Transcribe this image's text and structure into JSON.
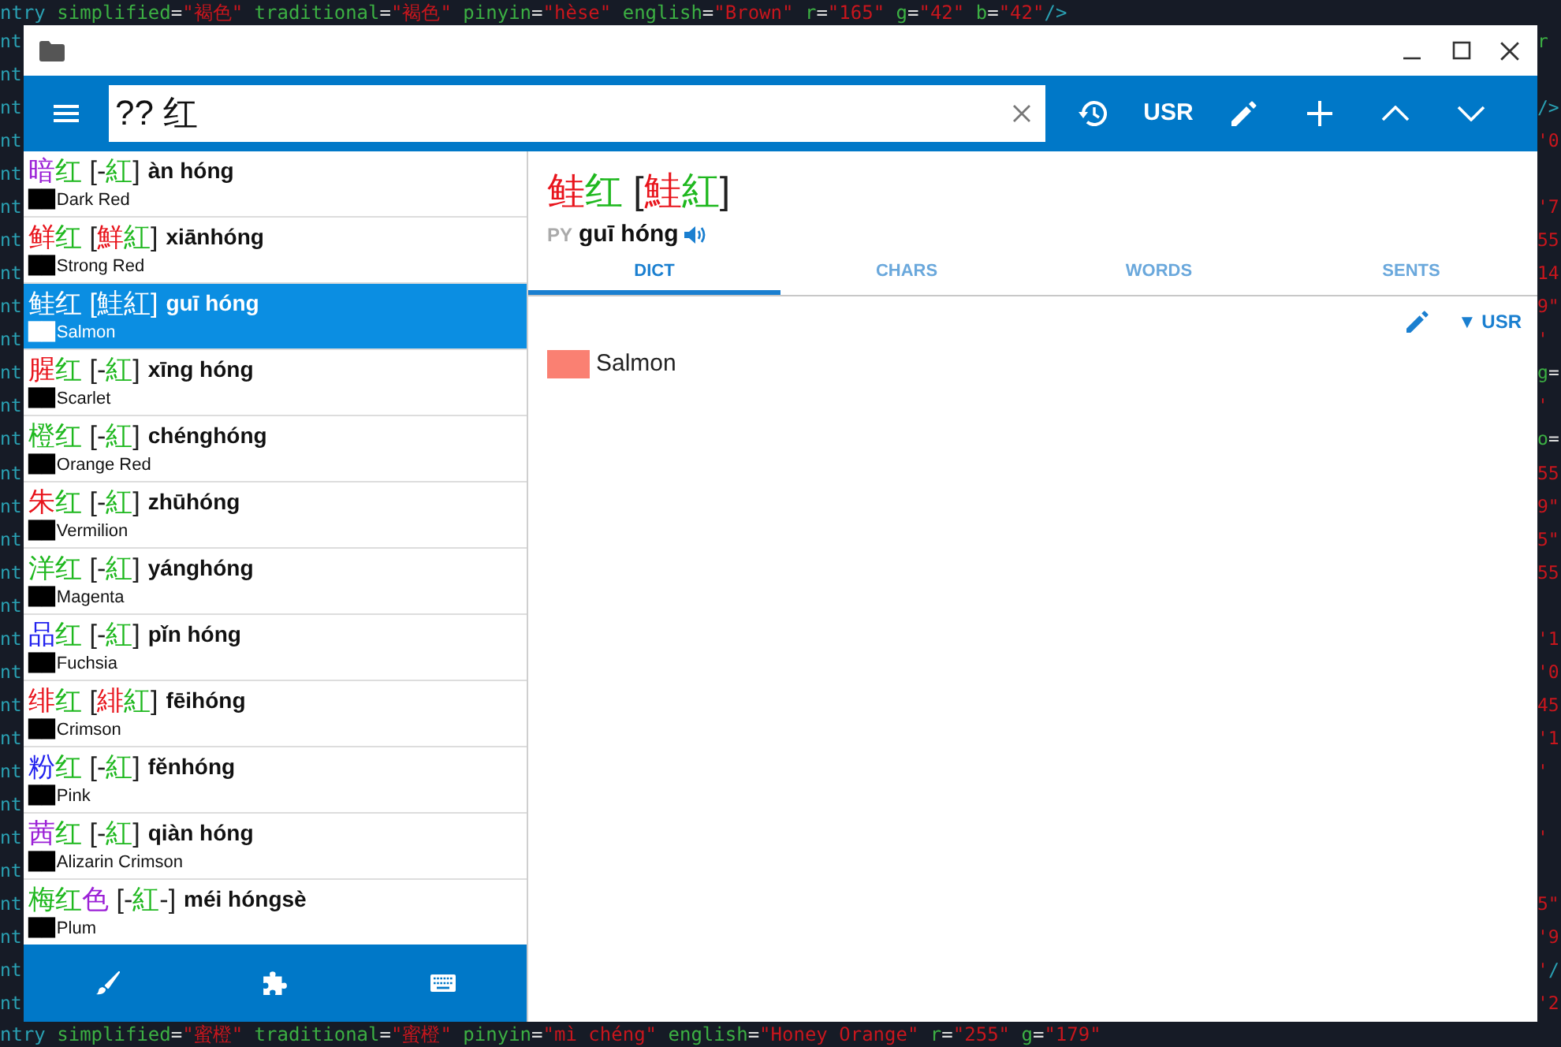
{
  "editor": {
    "top_line": [
      {
        "kind": "tag",
        "text": "ntry "
      },
      {
        "kind": "attr",
        "text": "simplified"
      },
      {
        "kind": "punct",
        "text": "="
      },
      {
        "kind": "string",
        "text": "\"褐色\""
      },
      {
        "kind": "attr",
        "text": " traditional"
      },
      {
        "kind": "punct",
        "text": "="
      },
      {
        "kind": "string",
        "text": "\"褐色\""
      },
      {
        "kind": "attr",
        "text": " pinyin"
      },
      {
        "kind": "punct",
        "text": "="
      },
      {
        "kind": "string",
        "text": "\"hèse\""
      },
      {
        "kind": "attr",
        "text": " english"
      },
      {
        "kind": "punct",
        "text": "="
      },
      {
        "kind": "string",
        "text": "\"Brown\""
      },
      {
        "kind": "attr",
        "text": " r"
      },
      {
        "kind": "punct",
        "text": "="
      },
      {
        "kind": "string",
        "text": "\"165\""
      },
      {
        "kind": "attr",
        "text": " g"
      },
      {
        "kind": "punct",
        "text": "="
      },
      {
        "kind": "string",
        "text": "\"42\""
      },
      {
        "kind": "attr",
        "text": " b"
      },
      {
        "kind": "punct",
        "text": "="
      },
      {
        "kind": "string",
        "text": "\"42\""
      },
      {
        "kind": "tag",
        "text": "/>"
      }
    ],
    "lines": [
      {
        "left": "nt",
        "right": [
          {
            "kind": "attr",
            "text": "r"
          }
        ]
      },
      {
        "left": "nt"
      },
      {
        "left": "nt",
        "right": [
          {
            "kind": "tag",
            "text": "/>"
          }
        ]
      },
      {
        "left": "nt",
        "right": [
          {
            "kind": "string",
            "text": "'0"
          }
        ]
      },
      {
        "left": "nt"
      },
      {
        "left": "nt",
        "right": [
          {
            "kind": "string",
            "text": "'7"
          }
        ]
      },
      {
        "left": "nt",
        "right": [
          {
            "kind": "string",
            "text": "55"
          }
        ]
      },
      {
        "left": "nt",
        "right": [
          {
            "kind": "string",
            "text": "14"
          }
        ]
      },
      {
        "left": "nt",
        "right": [
          {
            "kind": "string",
            "text": "9\""
          }
        ]
      },
      {
        "left": "nt",
        "right": [
          {
            "kind": "string",
            "text": "'"
          }
        ]
      },
      {
        "left": "nt",
        "right": [
          {
            "kind": "attr",
            "text": "g"
          },
          {
            "kind": "punct",
            "text": "="
          }
        ]
      },
      {
        "left": "nt",
        "right": [
          {
            "kind": "string",
            "text": "'"
          }
        ]
      },
      {
        "left": "nt",
        "right": [
          {
            "kind": "attr",
            "text": "o"
          },
          {
            "kind": "punct",
            "text": "="
          }
        ]
      },
      {
        "left": "nt",
        "right": [
          {
            "kind": "string",
            "text": "55"
          }
        ]
      },
      {
        "left": "nt",
        "right": [
          {
            "kind": "string",
            "text": "9\""
          }
        ]
      },
      {
        "left": "nt",
        "right": [
          {
            "kind": "string",
            "text": "5\""
          }
        ]
      },
      {
        "left": "nt",
        "right": [
          {
            "kind": "string",
            "text": "55"
          }
        ]
      },
      {
        "left": "nt"
      },
      {
        "left": "nt",
        "right": [
          {
            "kind": "string",
            "text": "'1"
          }
        ]
      },
      {
        "left": "nt",
        "right": [
          {
            "kind": "string",
            "text": "'0"
          }
        ]
      },
      {
        "left": "nt",
        "right": [
          {
            "kind": "string",
            "text": "45"
          }
        ]
      },
      {
        "left": "nt",
        "right": [
          {
            "kind": "string",
            "text": "'1"
          }
        ]
      },
      {
        "left": "nt",
        "right": [
          {
            "kind": "string",
            "text": "'"
          }
        ]
      },
      {
        "left": "nt"
      },
      {
        "left": "nt",
        "right": [
          {
            "kind": "string",
            "text": "'"
          }
        ]
      },
      {
        "left": "nt"
      },
      {
        "left": "nt",
        "right": [
          {
            "kind": "string",
            "text": "5\""
          }
        ]
      },
      {
        "left": "nt",
        "right": [
          {
            "kind": "string",
            "text": "'9"
          }
        ]
      },
      {
        "left": "nt",
        "right": [
          {
            "kind": "string",
            "text": "'"
          },
          {
            "kind": "tag",
            "text": "/"
          }
        ]
      },
      {
        "left": "nt",
        "right": [
          {
            "kind": "string",
            "text": "'2"
          }
        ]
      }
    ],
    "bottom_line": [
      {
        "kind": "tag",
        "text": "ntry "
      },
      {
        "kind": "attr",
        "text": "simplified"
      },
      {
        "kind": "punct",
        "text": "="
      },
      {
        "kind": "string",
        "text": "\"蜜橙\""
      },
      {
        "kind": "attr",
        "text": " traditional"
      },
      {
        "kind": "punct",
        "text": "="
      },
      {
        "kind": "string",
        "text": "\"蜜橙\""
      },
      {
        "kind": "attr",
        "text": " pinyin"
      },
      {
        "kind": "punct",
        "text": "="
      },
      {
        "kind": "string",
        "text": "\"mì chéng\""
      },
      {
        "kind": "attr",
        "text": " english"
      },
      {
        "kind": "punct",
        "text": "="
      },
      {
        "kind": "string",
        "text": "\"Honey Orange\""
      },
      {
        "kind": "attr",
        "text": " r"
      },
      {
        "kind": "punct",
        "text": "="
      },
      {
        "kind": "string",
        "text": "\"255\""
      },
      {
        "kind": "attr",
        "text": " g"
      },
      {
        "kind": "punct",
        "text": "="
      },
      {
        "kind": "string",
        "text": "\"179\""
      }
    ]
  },
  "toolbar": {
    "search": {
      "value": "?? 红"
    },
    "dictionary_button": "USR"
  },
  "results": [
    {
      "selected": false,
      "simplified": [
        {
          "char": "暗",
          "color": "#9b20d6"
        },
        {
          "char": "红",
          "color": "#1fb81f"
        }
      ],
      "traditional": [
        {
          "char": "[",
          "color": "#222222"
        },
        {
          "char": "-",
          "color": "#222222"
        },
        {
          "char": "紅",
          "color": "#1fb81f"
        },
        {
          "char": "]",
          "color": "#222222"
        }
      ],
      "pinyin": "àn hóng",
      "swatch": "██",
      "english": "Dark Red"
    },
    {
      "selected": false,
      "simplified": [
        {
          "char": "鲜",
          "color": "#e8141c"
        },
        {
          "char": "红",
          "color": "#1fb81f"
        }
      ],
      "traditional": [
        {
          "char": "[",
          "color": "#222222"
        },
        {
          "char": "鮮",
          "color": "#e8141c"
        },
        {
          "char": "紅",
          "color": "#1fb81f"
        },
        {
          "char": "]",
          "color": "#222222"
        }
      ],
      "pinyin": "xiānhóng",
      "swatch": "██",
      "english": "Strong Red"
    },
    {
      "selected": true,
      "simplified": [
        {
          "char": "鲑"
        },
        {
          "char": "红"
        }
      ],
      "traditional": [
        {
          "char": "["
        },
        {
          "char": "鮭"
        },
        {
          "char": "紅"
        },
        {
          "char": "]"
        }
      ],
      "pinyin": "guī hóng",
      "swatch": "██",
      "english": "Salmon"
    },
    {
      "selected": false,
      "simplified": [
        {
          "char": "腥",
          "color": "#e8141c"
        },
        {
          "char": "红",
          "color": "#1fb81f"
        }
      ],
      "traditional": [
        {
          "char": "[",
          "color": "#222222"
        },
        {
          "char": "-",
          "color": "#222222"
        },
        {
          "char": "紅",
          "color": "#1fb81f"
        },
        {
          "char": "]",
          "color": "#222222"
        }
      ],
      "pinyin": "xīng hóng",
      "swatch": "██",
      "english": "Scarlet"
    },
    {
      "selected": false,
      "simplified": [
        {
          "char": "橙",
          "color": "#1fb81f"
        },
        {
          "char": "红",
          "color": "#1fb81f"
        }
      ],
      "traditional": [
        {
          "char": "[",
          "color": "#222222"
        },
        {
          "char": "-",
          "color": "#222222"
        },
        {
          "char": "紅",
          "color": "#1fb81f"
        },
        {
          "char": "]",
          "color": "#222222"
        }
      ],
      "pinyin": "chénghóng",
      "swatch": "██",
      "english": "Orange Red"
    },
    {
      "selected": false,
      "simplified": [
        {
          "char": "朱",
          "color": "#e8141c"
        },
        {
          "char": "红",
          "color": "#1fb81f"
        }
      ],
      "traditional": [
        {
          "char": "[",
          "color": "#222222"
        },
        {
          "char": "-",
          "color": "#222222"
        },
        {
          "char": "紅",
          "color": "#1fb81f"
        },
        {
          "char": "]",
          "color": "#222222"
        }
      ],
      "pinyin": "zhūhóng",
      "swatch": "██",
      "english": "Vermilion"
    },
    {
      "selected": false,
      "simplified": [
        {
          "char": "洋",
          "color": "#1fb81f"
        },
        {
          "char": "红",
          "color": "#1fb81f"
        }
      ],
      "traditional": [
        {
          "char": "[",
          "color": "#222222"
        },
        {
          "char": "-",
          "color": "#222222"
        },
        {
          "char": "紅",
          "color": "#1fb81f"
        },
        {
          "char": "]",
          "color": "#222222"
        }
      ],
      "pinyin": "yánghóng",
      "swatch": "██",
      "english": "Magenta"
    },
    {
      "selected": false,
      "simplified": [
        {
          "char": "品",
          "color": "#2222ee"
        },
        {
          "char": "红",
          "color": "#1fb81f"
        }
      ],
      "traditional": [
        {
          "char": "[",
          "color": "#222222"
        },
        {
          "char": "-",
          "color": "#222222"
        },
        {
          "char": "紅",
          "color": "#1fb81f"
        },
        {
          "char": "]",
          "color": "#222222"
        }
      ],
      "pinyin": "pǐn hóng",
      "swatch": "██",
      "english": "Fuchsia"
    },
    {
      "selected": false,
      "simplified": [
        {
          "char": "绯",
          "color": "#e8141c"
        },
        {
          "char": "红",
          "color": "#1fb81f"
        }
      ],
      "traditional": [
        {
          "char": "[",
          "color": "#222222"
        },
        {
          "char": "緋",
          "color": "#e8141c"
        },
        {
          "char": "紅",
          "color": "#1fb81f"
        },
        {
          "char": "]",
          "color": "#222222"
        }
      ],
      "pinyin": "fēihóng",
      "swatch": "██",
      "english": "Crimson"
    },
    {
      "selected": false,
      "simplified": [
        {
          "char": "粉",
          "color": "#2222ee"
        },
        {
          "char": "红",
          "color": "#1fb81f"
        }
      ],
      "traditional": [
        {
          "char": "[",
          "color": "#222222"
        },
        {
          "char": "-",
          "color": "#222222"
        },
        {
          "char": "紅",
          "color": "#1fb81f"
        },
        {
          "char": "]",
          "color": "#222222"
        }
      ],
      "pinyin": "fěnhóng",
      "swatch": "██",
      "english": "Pink"
    },
    {
      "selected": false,
      "simplified": [
        {
          "char": "茜",
          "color": "#9b20d6"
        },
        {
          "char": "红",
          "color": "#1fb81f"
        }
      ],
      "traditional": [
        {
          "char": "[",
          "color": "#222222"
        },
        {
          "char": "-",
          "color": "#222222"
        },
        {
          "char": "紅",
          "color": "#1fb81f"
        },
        {
          "char": "]",
          "color": "#222222"
        }
      ],
      "pinyin": "qiàn hóng",
      "swatch": "██",
      "english": "Alizarin Crimson"
    },
    {
      "selected": false,
      "simplified": [
        {
          "char": "梅",
          "color": "#1fb81f"
        },
        {
          "char": "红",
          "color": "#1fb81f"
        },
        {
          "char": "色",
          "color": "#9b20d6"
        }
      ],
      "traditional": [
        {
          "char": "[",
          "color": "#222222"
        },
        {
          "char": "-",
          "color": "#222222"
        },
        {
          "char": "紅",
          "color": "#1fb81f"
        },
        {
          "char": "-",
          "color": "#222222"
        },
        {
          "char": "]",
          "color": "#222222"
        }
      ],
      "pinyin": "méi hóngsè",
      "swatch": "██",
      "english": "Plum"
    }
  ],
  "detail": {
    "simplified": [
      {
        "char": "鲑",
        "color": "#e8141c"
      },
      {
        "char": "红",
        "color": "#1fb81f"
      }
    ],
    "traditional": [
      {
        "char": "[",
        "color": "#222222"
      },
      {
        "char": "鮭",
        "color": "#e8141c"
      },
      {
        "char": "紅",
        "color": "#1fb81f"
      },
      {
        "char": "]",
        "color": "#222222"
      }
    ],
    "pinyin_label": "PY",
    "pinyin": "guī hóng",
    "tabs": [
      {
        "label": "DICT",
        "selected": true
      },
      {
        "label": "CHARS",
        "selected": false
      },
      {
        "label": "WORDS",
        "selected": false
      },
      {
        "label": "SENTS",
        "selected": false
      }
    ],
    "dictionary_selector": "▼ USR",
    "definition": {
      "color": "#fa8072",
      "text": "Salmon"
    }
  }
}
